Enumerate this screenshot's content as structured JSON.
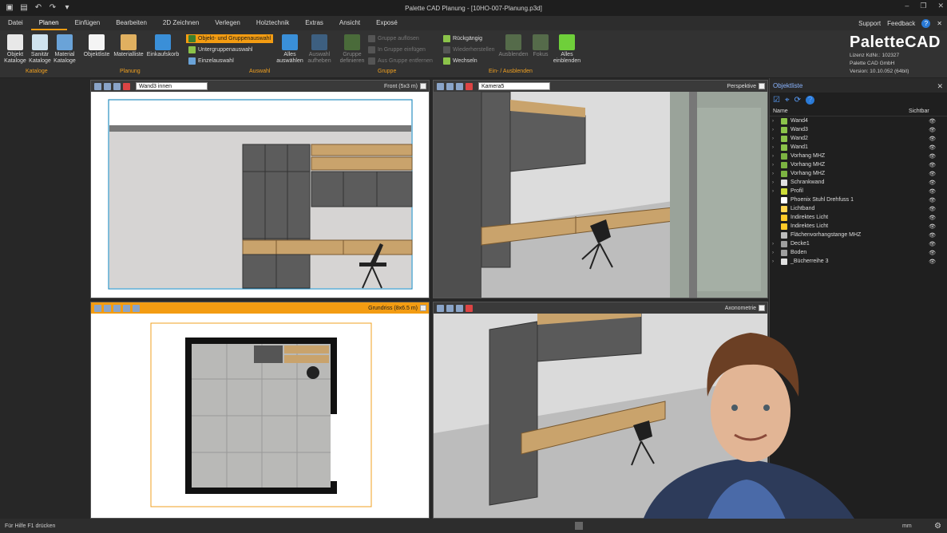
{
  "window": {
    "title": "Palette CAD Planung - [10HO-007-Planung.p3d]"
  },
  "menu": {
    "items": [
      "Datei",
      "Planen",
      "Einfügen",
      "Bearbeiten",
      "2D Zeichnen",
      "Verlegen",
      "Holztechnik",
      "Extras",
      "Ansicht",
      "Exposé"
    ],
    "active": 1,
    "support": "Support",
    "feedback": "Feedback",
    "help": "?"
  },
  "ribbon": {
    "objekt_kataloge": "Objekt Kataloge",
    "sanitaer_kataloge": "Sanitär Kataloge",
    "material_kataloge": "Material Kataloge",
    "objektliste": "Objektliste",
    "materialliste": "Materialliste",
    "einkaufskorb": "Einkaufskorb",
    "objekt_gruppenauswahl": "Objekt- und Gruppenauswahl",
    "untergruppenauswahl": "Untergruppenauswahl",
    "einzelauswahl": "Einzelauswahl",
    "alles_auswaehlen": "Alles auswählen",
    "auswahl_aufheben": "Auswahl aufheben",
    "gruppe_definieren": "Gruppe definieren",
    "gruppe_aufloesen": "Gruppe auflösen",
    "in_gruppe_einfuegen": "In Gruppe einfügen",
    "aus_gruppe_entfernen": "Aus Gruppe entfernen",
    "rueckgaengig": "Rückgängig",
    "wiederherstellen": "Wiederherstellen",
    "wechseln": "Wechseln",
    "ausblenden": "Ausblenden",
    "fokus": "Fokus",
    "alles_einblenden": "Alles einblenden",
    "groups": {
      "kataloge": "Kataloge",
      "planung": "Planung",
      "auswahl": "Auswahl",
      "gruppe": "Gruppe",
      "ein_ausblenden": "Ein- / Ausblenden"
    }
  },
  "brand": {
    "logo_a": "Palette",
    "logo_b": "CAD",
    "lizenz": "Lizenz KdNr.: 102327",
    "firma": "Palette CAD GmbH",
    "version": "Version: 10.10.052 (64bit)"
  },
  "viewports": {
    "front": {
      "select": "Wand3 innen",
      "label": "Front  (5x3 m)"
    },
    "perspektive": {
      "select": "Kamera5",
      "label": "Perspektive"
    },
    "grundriss": {
      "label": "Grundriss  (8x6.5 m)"
    },
    "axonometrie": {
      "label": "Axonometrie"
    }
  },
  "objektliste": {
    "title": "Objektliste",
    "col_name": "Name",
    "col_visible": "Sichtbar",
    "items": [
      {
        "name": "Wand4",
        "icon": "#8bc34a",
        "exp": true
      },
      {
        "name": "Wand3",
        "icon": "#8bc34a",
        "exp": true
      },
      {
        "name": "Wand2",
        "icon": "#8bc34a",
        "exp": true
      },
      {
        "name": "Wand1",
        "icon": "#8bc34a",
        "exp": true
      },
      {
        "name": "Vorhang MHZ",
        "icon": "#7cb342",
        "exp": true
      },
      {
        "name": "Vorhang MHZ",
        "icon": "#7cb342",
        "exp": true
      },
      {
        "name": "Vorhang MHZ",
        "icon": "#7cb342",
        "exp": true
      },
      {
        "name": "Schrankwand",
        "icon": "#e0e0e0",
        "exp": true
      },
      {
        "name": "Profil",
        "icon": "#cddc39",
        "exp": true
      },
      {
        "name": "Phoenix Stuhl Drehfuss 1",
        "icon": "#ffffff",
        "exp": false
      },
      {
        "name": "Lichtband",
        "icon": "#ffd54f",
        "exp": false
      },
      {
        "name": "Indirektes Licht",
        "icon": "#ffca28",
        "exp": false
      },
      {
        "name": "Indirektes Licht",
        "icon": "#ffca28",
        "exp": false
      },
      {
        "name": "Flächenvorhangstange MHZ",
        "icon": "#bdbdbd",
        "exp": false
      },
      {
        "name": "Decke1",
        "icon": "#9e9e9e",
        "exp": true
      },
      {
        "name": "Boden",
        "icon": "#9e9e9e",
        "exp": true
      },
      {
        "name": "_Bücherreihe 3",
        "icon": "#e0e0e0",
        "exp": true
      }
    ]
  },
  "status": {
    "hint": "Für Hilfe F1 drücken",
    "unit": "mm"
  }
}
